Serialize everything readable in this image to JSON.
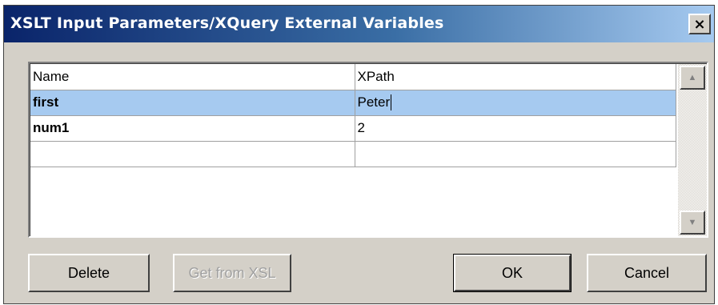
{
  "window": {
    "title": "XSLT Input Parameters/XQuery External Variables",
    "close_glyph": "×"
  },
  "grid": {
    "headers": [
      "Name",
      "XPath"
    ],
    "rows": [
      {
        "name": "first",
        "xpath": "Peter",
        "selected": true
      },
      {
        "name": "num1",
        "xpath": "2",
        "selected": false
      },
      {
        "name": "",
        "xpath": "",
        "selected": false
      }
    ],
    "scroll_up_icon": "▲",
    "scroll_down_icon": "▼"
  },
  "buttons": {
    "delete": "Delete",
    "get_from_xsl": "Get from XSL",
    "ok": "OK",
    "cancel": "Cancel"
  },
  "colors": {
    "selection": "#a6caf0",
    "titlebar_start": "#0a246a",
    "titlebar_end": "#a6caf0",
    "dialog_face": "#d4d0c8"
  }
}
